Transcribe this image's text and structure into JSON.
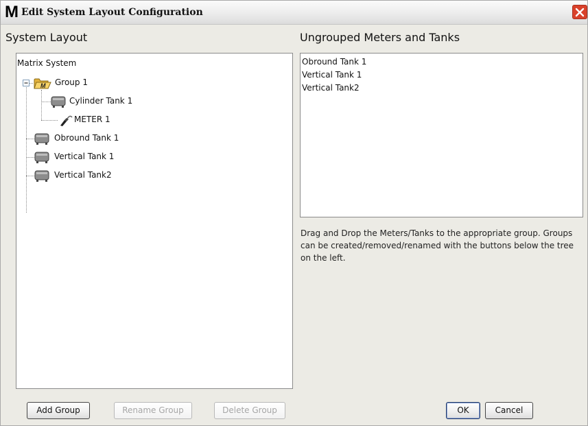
{
  "window": {
    "title": "Edit System Layout Configuration",
    "logo_letter": "M"
  },
  "left": {
    "title": "System Layout",
    "tree": {
      "root": "Matrix System",
      "group": "Group 1",
      "group_children": [
        "Cylinder Tank 1",
        "METER 1"
      ],
      "items": [
        "Obround Tank 1",
        "Vertical Tank 1",
        "Vertical Tank2"
      ]
    },
    "buttons": {
      "add": "Add Group",
      "rename": "Rename Group",
      "delete": "Delete Group"
    }
  },
  "right": {
    "title": "Ungrouped Meters and Tanks",
    "items": [
      "Obround Tank 1",
      "Vertical Tank 1",
      "Vertical Tank2"
    ],
    "hint": "Drag and Drop the Meters/Tanks to the appropriate group. Groups can be created/removed/renamed with the buttons below the tree on the left."
  },
  "footer": {
    "ok": "OK",
    "cancel": "Cancel"
  },
  "icons": {
    "logo": "app-logo-icon",
    "close": "close-icon",
    "collapse": "collapse-toggle-icon",
    "folder": "folder-icon",
    "tank": "tank-icon",
    "meter": "meter-nozzle-icon"
  },
  "colors": {
    "close_button": "#d9412a",
    "window_bg": "#ecebe5"
  }
}
